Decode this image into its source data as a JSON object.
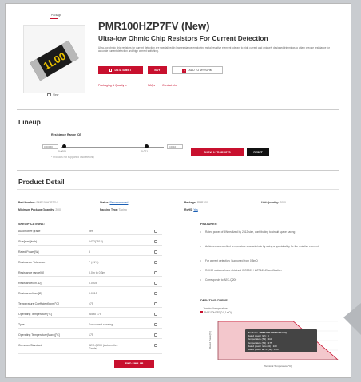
{
  "product": {
    "tag": "Package",
    "name": "PMR100HZP7FV (New)",
    "subtitle": "Ultra-low Ohmic Chip Resistors For Current Detection",
    "description": "Ultra-low ohmic chip resistors for current detection are specialized in low resistance employing metal resistive element tolerant to high current and uniquely designed trimmings to attain precise resistance for accurate current detection and high current switching.",
    "chip_marking": "1L00",
    "view_label": "View"
  },
  "actions": {
    "datasheet": "DATA SHEET",
    "buy": "BUY",
    "add_myrohm": "ADD TO MYROHM"
  },
  "links": {
    "packaging": "Packaging & Quality",
    "faqs": "FAQs",
    "contact": "Contact Us"
  },
  "lineup": {
    "title": "Lineup",
    "range_label": "Resistance Range [Ω]",
    "min_value": "0.00050",
    "max_value": "0.0010",
    "min_tick": "0.0005",
    "max_tick": "0.001",
    "note": "* Products not supported discrete only",
    "show_button": "SHOW 1 PRODUCTS",
    "reset_button": "RESET"
  },
  "detail": {
    "title": "Product Detail",
    "part_number_label": "Part Number:",
    "part_number_value": "PMR100HZP7FV",
    "status_label": "Status:",
    "status_value": "Recommended",
    "package_label": "Package:",
    "package_value": "PMR100",
    "unit_qty_label": "Unit Quantity:",
    "unit_qty_value": "2000",
    "min_pkg_label": "Minimum Package Quantity:",
    "min_pkg_value": "2000",
    "packing_label": "Packing Type:",
    "packing_value": "Taping",
    "rohs_label": "RoHS:",
    "rohs_value": "Yes"
  },
  "specs": {
    "title": "SPECIFICATIONS:",
    "rows": [
      {
        "k": "Automotive grade",
        "v": "Yes"
      },
      {
        "k": "Size[mm](inch)",
        "v": "6432(2512)"
      },
      {
        "k": "Rated Power[W]",
        "v": "5"
      },
      {
        "k": "Resistance Tolerance",
        "v": "F (±1%)"
      },
      {
        "k": "Resistance range[Ω]",
        "v": "0.0m to 0.3m"
      },
      {
        "k": "ResistanceMin.[Ω]",
        "v": "0.0005"
      },
      {
        "k": "ResistanceMax.[Ω]",
        "v": "0.0015"
      },
      {
        "k": "Temperature Coefficient[ppm/°C]",
        "v": "±75"
      },
      {
        "k": "Operating Temperature[°C]",
        "v": "-65 to 175"
      },
      {
        "k": "Type",
        "v": "For current sensing"
      },
      {
        "k": "Operating Temperature(Max.)[°C]",
        "v": "175"
      },
      {
        "k": "Common Standard",
        "v": "AEC-Q200 (Automotive Grade)"
      }
    ],
    "find_similar": "FIND SIMILAR"
  },
  "features": {
    "title": "FEATURES:",
    "items": [
      "Rated power of 5W realized by 2512 size, contributing to circuit space saving",
      "Achieved an excellent temperature characteristic by using a special alloy for the resistive element",
      "For current detection: Supported from 0.5mΩ",
      "ROHM resistors have obtained ISO9001 / IATF16949 certification",
      "Corresponds to AEC-Q200"
    ]
  },
  "derating": {
    "title": "DERATING CURVE:",
    "legend_title": "Terminal temperature",
    "legend_series": "PMR100HZP7(0.5,1mΩ)",
    "y_label": "Rated Power[%]",
    "x_label": "Terminal Temperature[°C]",
    "tooltip_title": "Products : PMR100HZP7(0.5,1mΩ)",
    "tooltip_lines": [
      "Rated power (W) : 5",
      "Temperature (T1) : 110",
      "Temperature (T2) : 175",
      "Rated power ratio (%) : 100",
      "Rated power at T1 (W) : 0.00"
    ]
  },
  "colors": {
    "accent": "#c8102e",
    "chart_fill": "#f3c7cc"
  },
  "chart_data": {
    "type": "area",
    "title": "",
    "xlabel": "Terminal Temperature[°C]",
    "ylabel": "Rated Power[%]",
    "series": [
      {
        "name": "PMR100HZP7(0.5,1mΩ)",
        "x": [
          0,
          110,
          175
        ],
        "y": [
          100,
          100,
          0
        ]
      }
    ],
    "xlim": [
      0,
      175
    ],
    "ylim": [
      0,
      100
    ],
    "grid": true,
    "legend": "top-left"
  }
}
